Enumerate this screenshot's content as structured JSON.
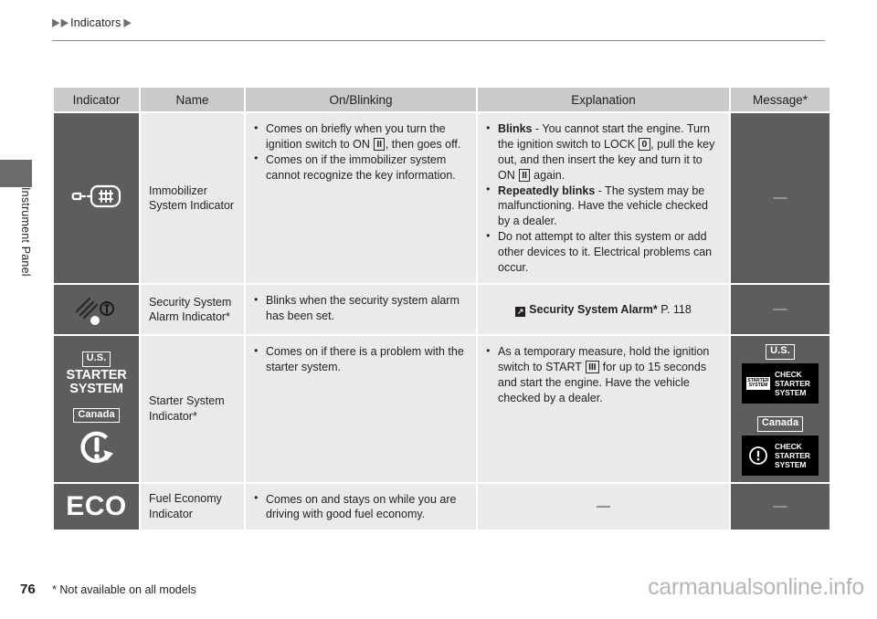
{
  "breadcrumb": {
    "marker_1": "▶",
    "marker_2": "▶",
    "text": "Indicators",
    "marker_3": "▶"
  },
  "chapter": {
    "label": "Instrument Panel"
  },
  "table": {
    "headers": {
      "indicator": "Indicator",
      "name": "Name",
      "on_blinking": "On/Blinking",
      "explanation": "Explanation",
      "message": "Message*"
    },
    "rows": [
      {
        "icon_name": "immobilizer-key-icon",
        "name": "Immobilizer\nSystem Indicator",
        "on_blinking": [
          {
            "parts": [
              {
                "t": "Comes on briefly when you turn the ignition switch to ON "
              },
              {
                "box": "II"
              },
              {
                "t": ", then goes off."
              }
            ]
          },
          {
            "parts": [
              {
                "t": "Comes on if the immobilizer system cannot recognize the key information."
              }
            ]
          }
        ],
        "explanation": [
          {
            "parts": [
              {
                "b": "Blinks"
              },
              {
                "t": " - You cannot start the engine. Turn the ignition switch to LOCK "
              },
              {
                "box": "0"
              },
              {
                "t": ", pull the key out, and then insert the key and turn it to ON "
              },
              {
                "box": "II"
              },
              {
                "t": " again."
              }
            ]
          },
          {
            "parts": [
              {
                "b": "Repeatedly blinks"
              },
              {
                "t": " - The system may be malfunctioning. Have the vehicle checked by a dealer."
              }
            ]
          },
          {
            "parts": [
              {
                "t": "Do not attempt to alter this system or add other devices to it. Electrical problems can occur."
              }
            ]
          }
        ],
        "message": "—"
      },
      {
        "icon_name": "security-alarm-icon",
        "name": "Security System\nAlarm Indicator*",
        "on_blinking": [
          {
            "parts": [
              {
                "t": "Blinks when the security system alarm has been set."
              }
            ]
          }
        ],
        "explanation_ref": {
          "arrow": "↗",
          "title": "Security System Alarm*",
          "page": "P. 118"
        },
        "message": "—"
      },
      {
        "icon_name": "starter-system-icon",
        "icon_us_tag": "U.S.",
        "icon_us_line1": "STARTER",
        "icon_us_line2": "SYSTEM",
        "icon_canada_tag": "Canada",
        "name": "Starter System\nIndicator*",
        "on_blinking": [
          {
            "parts": [
              {
                "t": "Comes on if there is a problem with the starter system."
              }
            ]
          }
        ],
        "explanation": [
          {
            "parts": [
              {
                "t": "As a temporary measure, hold the ignition switch to START "
              },
              {
                "box": "III"
              },
              {
                "t": " for up to 15 seconds and start the engine. Have the vehicle checked by a dealer."
              }
            ]
          }
        ],
        "message_tiles": {
          "us_tag": "U.S.",
          "us_chip_line1": "STARTER",
          "us_chip_line2": "SYSTEM",
          "us_text_line1": "CHECK",
          "us_text_line2": "STARTER",
          "us_text_line3": "SYSTEM",
          "canada_tag": "Canada",
          "canada_text_line1": "CHECK",
          "canada_text_line2": "STARTER",
          "canada_text_line3": "SYSTEM"
        }
      },
      {
        "icon_name": "eco-indicator-icon",
        "icon_text": "ECO",
        "name": "Fuel Economy\nIndicator",
        "on_blinking": [
          {
            "parts": [
              {
                "t": "Comes on and stays on while you are driving with good fuel economy."
              }
            ]
          }
        ],
        "explanation_dash": "—",
        "message": "—"
      }
    ]
  },
  "footer": {
    "page_number": "76",
    "footnote": "* Not available on all models",
    "watermark": "carmanualsonline.info"
  },
  "colors": {
    "header_bg": "#cacaca",
    "icon_cell_bg": "#5d5d5d",
    "body_cell_bg": "#eaeaea",
    "text": "#231f20",
    "tab_gray": "#6b6b6b"
  }
}
